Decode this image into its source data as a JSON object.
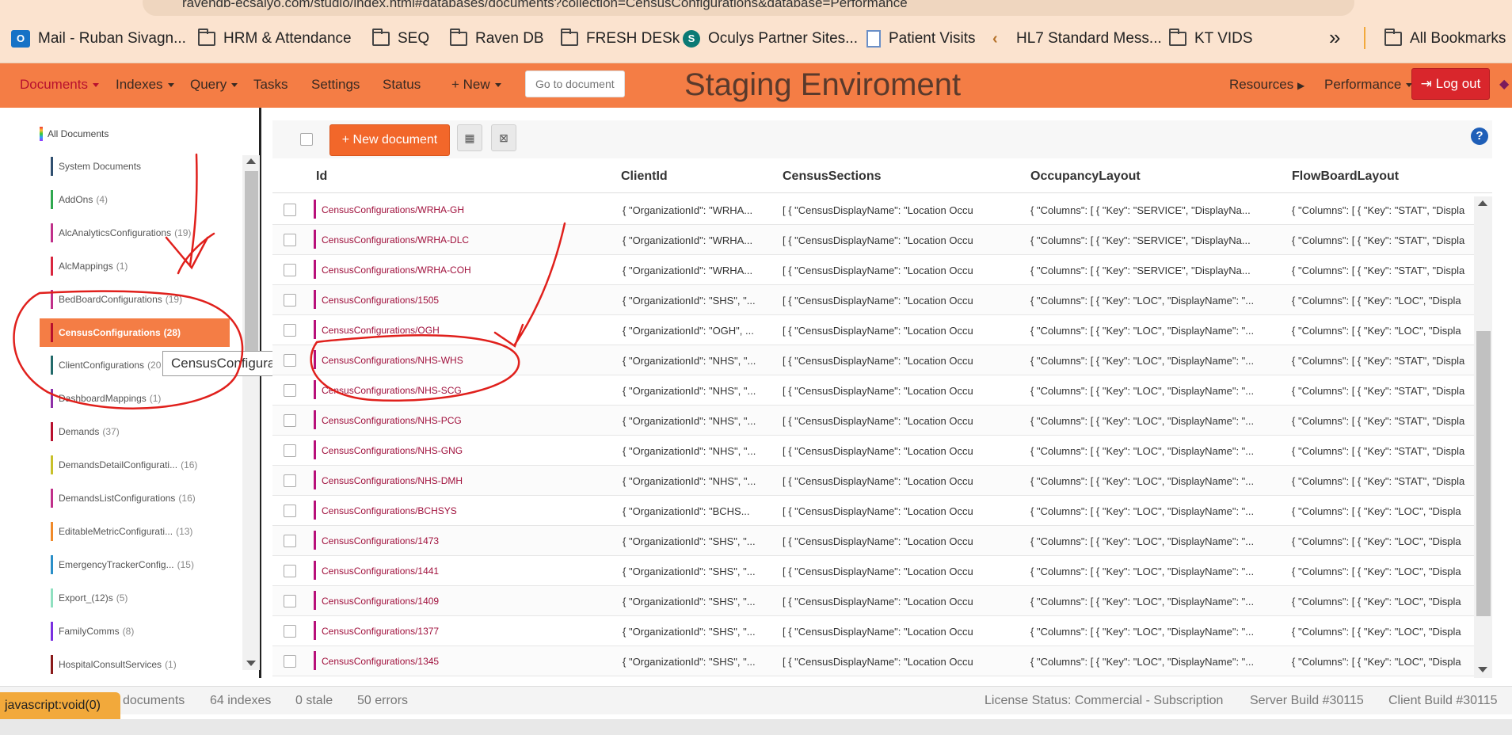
{
  "browser": {
    "url": "ravendb-ecsalyo.com/studio/index.html#databases/documents?collection=CensusConfigurations&database=Performance",
    "bookmarks": [
      "Mail - Ruban Sivagn...",
      "HRM & Attendance",
      "SEQ",
      "Raven DB",
      "FRESH DESk",
      "Oculys Partner Sites...",
      "Patient Visits",
      "HL7 Standard Mess...",
      "KT VIDS"
    ],
    "more_label": "»",
    "all_bookmarks": "All Bookmarks"
  },
  "nav": {
    "documents": "Documents",
    "indexes": "Indexes",
    "query": "Query",
    "tasks": "Tasks",
    "settings": "Settings",
    "status": "Status",
    "new": "+ New",
    "goto_placeholder": "Go to document",
    "title": "Staging Enviroment",
    "resources": "Resources",
    "database": "Performance",
    "logout": "Log out"
  },
  "sidebar": {
    "all_documents": "All Documents",
    "collections": [
      {
        "name": "System Documents",
        "count": "",
        "color": "#2f4f6f"
      },
      {
        "name": "AddOns",
        "count": "(4)",
        "color": "#2fa84f"
      },
      {
        "name": "AlcAnalyticsConfigurations",
        "count": "(19)",
        "color": "#c0308a"
      },
      {
        "name": "AlcMappings",
        "count": "(1)",
        "color": "#d9263f"
      },
      {
        "name": "BedBoardConfigurations",
        "count": "(19)",
        "color": "#c0308a"
      },
      {
        "name": "CensusConfigurations",
        "count": "(28)",
        "color": "#b8102e"
      },
      {
        "name": "ClientConfigurations",
        "count": "(20",
        "color": "#226a6a"
      },
      {
        "name": "DashboardMappings",
        "count": "(1)",
        "color": "#8e2fa8"
      },
      {
        "name": "Demands",
        "count": "(37)",
        "color": "#b8102e"
      },
      {
        "name": "DemandsDetailConfigurati...",
        "count": "(16)",
        "color": "#c8c02a"
      },
      {
        "name": "DemandsListConfigurations",
        "count": "(16)",
        "color": "#c0308a"
      },
      {
        "name": "EditableMetricConfigurati...",
        "count": "(13)",
        "color": "#f08a2a"
      },
      {
        "name": "EmergencyTrackerConfig...",
        "count": "(15)",
        "color": "#2a8fc8"
      },
      {
        "name": "Export_(12)s",
        "count": "(5)",
        "color": "#8fe0c0"
      },
      {
        "name": "FamilyComms",
        "count": "(8)",
        "color": "#7a2fe0"
      },
      {
        "name": "HospitalConsultServices",
        "count": "(1)",
        "color": "#8a1a1a"
      }
    ],
    "tooltip": "CensusConfigurations"
  },
  "toolbar": {
    "new_document": "+ New document"
  },
  "table": {
    "columns": [
      "Id",
      "ClientId",
      "CensusSections",
      "OccupancyLayout",
      "FlowBoardLayout"
    ],
    "rows": [
      {
        "id": "CensusConfigurations/WRHA-GH",
        "client": "{ \"OrganizationId\": \"WRHA...",
        "census": "[ { \"CensusDisplayName\": \"Location Occupa...",
        "occupancy": "{ \"Columns\": [ { \"Key\": \"SERVICE\", \"DisplayNa...",
        "flow": "{ \"Columns\": [ { \"Key\": \"STAT\", \"Displa"
      },
      {
        "id": "CensusConfigurations/WRHA-DLC",
        "client": "{ \"OrganizationId\": \"WRHA...",
        "census": "[ { \"CensusDisplayName\": \"Location Occupa...",
        "occupancy": "{ \"Columns\": [ { \"Key\": \"SERVICE\", \"DisplayNa...",
        "flow": "{ \"Columns\": [ { \"Key\": \"STAT\", \"Displa"
      },
      {
        "id": "CensusConfigurations/WRHA-COH",
        "client": "{ \"OrganizationId\": \"WRHA...",
        "census": "[ { \"CensusDisplayName\": \"Location Occupa...",
        "occupancy": "{ \"Columns\": [ { \"Key\": \"SERVICE\", \"DisplayNa...",
        "flow": "{ \"Columns\": [ { \"Key\": \"STAT\", \"Displa"
      },
      {
        "id": "CensusConfigurations/1505",
        "client": "{ \"OrganizationId\": \"SHS\", \"...",
        "census": "[ { \"CensusDisplayName\": \"Location Occupa...",
        "occupancy": "{ \"Columns\": [ { \"Key\": \"LOC\", \"DisplayName\": \"...",
        "flow": "{ \"Columns\": [ { \"Key\": \"LOC\", \"Displa"
      },
      {
        "id": "CensusConfigurations/OGH",
        "client": "{ \"OrganizationId\": \"OGH\", ...",
        "census": "[ { \"CensusDisplayName\": \"Location Occupa...",
        "occupancy": "{ \"Columns\": [ { \"Key\": \"LOC\", \"DisplayName\": \"...",
        "flow": "{ \"Columns\": [ { \"Key\": \"LOC\", \"Displa"
      },
      {
        "id": "CensusConfigurations/NHS-WHS",
        "client": "{ \"OrganizationId\": \"NHS\", \"...",
        "census": "[ { \"CensusDisplayName\": \"Location Occupa...",
        "occupancy": "{ \"Columns\": [ { \"Key\": \"LOC\", \"DisplayName\": \"...",
        "flow": "{ \"Columns\": [ { \"Key\": \"STAT\", \"Displa"
      },
      {
        "id": "CensusConfigurations/NHS-SCG",
        "client": "{ \"OrganizationId\": \"NHS\", \"...",
        "census": "[ { \"CensusDisplayName\": \"Location Occupa...",
        "occupancy": "{ \"Columns\": [ { \"Key\": \"LOC\", \"DisplayName\": \"...",
        "flow": "{ \"Columns\": [ { \"Key\": \"STAT\", \"Displa"
      },
      {
        "id": "CensusConfigurations/NHS-PCG",
        "client": "{ \"OrganizationId\": \"NHS\", \"...",
        "census": "[ { \"CensusDisplayName\": \"Location Occupa...",
        "occupancy": "{ \"Columns\": [ { \"Key\": \"LOC\", \"DisplayName\": \"...",
        "flow": "{ \"Columns\": [ { \"Key\": \"STAT\", \"Displa"
      },
      {
        "id": "CensusConfigurations/NHS-GNG",
        "client": "{ \"OrganizationId\": \"NHS\", \"...",
        "census": "[ { \"CensusDisplayName\": \"Location Occupa...",
        "occupancy": "{ \"Columns\": [ { \"Key\": \"LOC\", \"DisplayName\": \"...",
        "flow": "{ \"Columns\": [ { \"Key\": \"STAT\", \"Displa"
      },
      {
        "id": "CensusConfigurations/NHS-DMH",
        "client": "{ \"OrganizationId\": \"NHS\", \"...",
        "census": "[ { \"CensusDisplayName\": \"Location Occupa...",
        "occupancy": "{ \"Columns\": [ { \"Key\": \"LOC\", \"DisplayName\": \"...",
        "flow": "{ \"Columns\": [ { \"Key\": \"STAT\", \"Displa"
      },
      {
        "id": "CensusConfigurations/BCHSYS",
        "client": "{ \"OrganizationId\": \"BCHS...",
        "census": "[ { \"CensusDisplayName\": \"Location Occupa...",
        "occupancy": "{ \"Columns\": [ { \"Key\": \"LOC\", \"DisplayName\": \"...",
        "flow": "{ \"Columns\": [ { \"Key\": \"LOC\", \"Displa"
      },
      {
        "id": "CensusConfigurations/1473",
        "client": "{ \"OrganizationId\": \"SHS\", \"...",
        "census": "[ { \"CensusDisplayName\": \"Location Occupa...",
        "occupancy": "{ \"Columns\": [ { \"Key\": \"LOC\", \"DisplayName\": \"...",
        "flow": "{ \"Columns\": [ { \"Key\": \"LOC\", \"Displa"
      },
      {
        "id": "CensusConfigurations/1441",
        "client": "{ \"OrganizationId\": \"SHS\", \"...",
        "census": "[ { \"CensusDisplayName\": \"Location Occupa...",
        "occupancy": "{ \"Columns\": [ { \"Key\": \"LOC\", \"DisplayName\": \"...",
        "flow": "{ \"Columns\": [ { \"Key\": \"LOC\", \"Displa"
      },
      {
        "id": "CensusConfigurations/1409",
        "client": "{ \"OrganizationId\": \"SHS\", \"...",
        "census": "[ { \"CensusDisplayName\": \"Location Occupa...",
        "occupancy": "{ \"Columns\": [ { \"Key\": \"LOC\", \"DisplayName\": \"...",
        "flow": "{ \"Columns\": [ { \"Key\": \"LOC\", \"Displa"
      },
      {
        "id": "CensusConfigurations/1377",
        "client": "{ \"OrganizationId\": \"SHS\", \"...",
        "census": "[ { \"CensusDisplayName\": \"Location Occupa...",
        "occupancy": "{ \"Columns\": [ { \"Key\": \"LOC\", \"DisplayName\": \"...",
        "flow": "{ \"Columns\": [ { \"Key\": \"LOC\", \"Displa"
      },
      {
        "id": "CensusConfigurations/1345",
        "client": "{ \"OrganizationId\": \"SHS\", \"...",
        "census": "[ { \"CensusDisplayName\": \"Location Occupa...",
        "occupancy": "{ \"Columns\": [ { \"Key\": \"LOC\", \"DisplayName\": \"...",
        "flow": "{ \"Columns\": [ { \"Key\": \"LOC\", \"Displa"
      }
    ]
  },
  "footer": {
    "documents": "documents",
    "indexes": "64 indexes",
    "stale": "0 stale",
    "errors": "50 errors",
    "license": "License Status: Commercial - Subscription",
    "server_build": "Server Build #30115",
    "client_build": "Client Build #30115",
    "status_link": "javascript:void(0)"
  },
  "colors": {
    "nav_bg": "#f47d45",
    "accent": "#f2672a",
    "active_collection": "#f47d45",
    "logout": "#d9262c",
    "annotation": "#e0201c"
  }
}
